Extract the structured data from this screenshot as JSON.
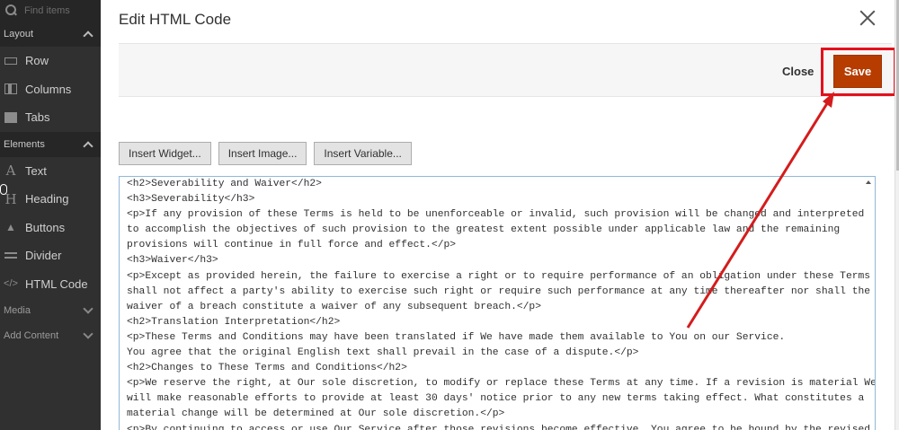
{
  "sidebar": {
    "search_placeholder": "Find items",
    "sections": [
      {
        "label": "Layout",
        "items": [
          {
            "label": "Row",
            "icon": "row-icon"
          },
          {
            "label": "Columns",
            "icon": "columns-icon"
          },
          {
            "label": "Tabs",
            "icon": "tabs-icon"
          }
        ]
      },
      {
        "label": "Elements",
        "items": [
          {
            "label": "Text",
            "icon": "text-icon"
          },
          {
            "label": "Heading",
            "icon": "heading-icon"
          },
          {
            "label": "Buttons",
            "icon": "cursor-icon"
          },
          {
            "label": "Divider",
            "icon": "divider-icon"
          },
          {
            "label": "HTML Code",
            "icon": "code-icon"
          }
        ]
      },
      {
        "label": "Media"
      },
      {
        "label": "Add Content"
      }
    ]
  },
  "modal": {
    "title": "Edit HTML Code",
    "close_label": "Close",
    "save_label": "Save",
    "buttons": [
      "Insert Widget...",
      "Insert Image...",
      "Insert Variable..."
    ],
    "code_lines": [
      "<h2>Severability and Waiver</h2>",
      "<h3>Severability</h3>",
      "<p>If any provision of these Terms is held to be unenforceable or invalid, such provision will be changed and interpreted",
      "to accomplish the objectives of such provision to the greatest extent possible under applicable law and the remaining",
      "provisions will continue in full force and effect.</p>",
      "<h3>Waiver</h3>",
      "<p>Except as provided herein, the failure to exercise a right or to require performance of an obligation under these Terms",
      "shall not affect a party's ability to exercise such right or require such performance at any time thereafter nor shall the",
      "waiver of a breach constitute a waiver of any subsequent breach.</p>",
      "<h2>Translation Interpretation</h2>",
      "<p>These Terms and Conditions may have been translated if We have made them available to You on our Service.",
      "You agree that the original English text shall prevail in the case of a dispute.</p>",
      "<h2>Changes to These Terms and Conditions</h2>",
      "<p>We reserve the right, at Our sole discretion, to modify or replace these Terms at any time. If a revision is material We",
      "will make reasonable efforts to provide at least 30 days' notice prior to any new terms taking effect. What constitutes a",
      "material change will be determined at Our sole discretion.</p>",
      "<p>By continuing to access or use Our Service after those revisions become effective, You agree to be bound by the revised"
    ]
  },
  "colors": {
    "sidebar_bg": "#303030",
    "save_bg": "#b63c00",
    "highlight": "#e3101c"
  }
}
